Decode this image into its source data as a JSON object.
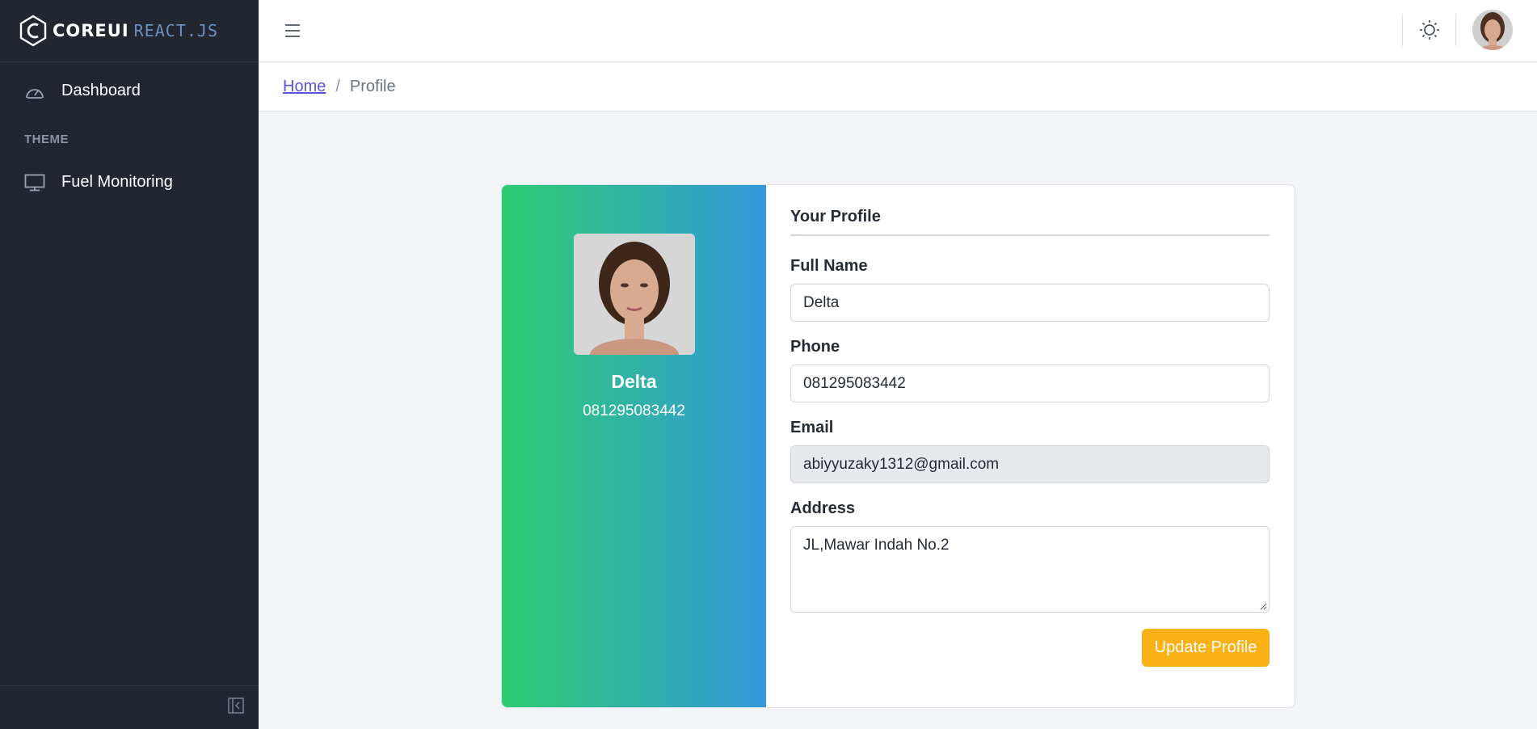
{
  "brand": {
    "core": "COREUI",
    "react": "REACT.JS"
  },
  "sidebar": {
    "items": [
      {
        "label": "Dashboard",
        "icon": "speedometer-icon"
      },
      {
        "label": "Fuel Monitoring",
        "icon": "monitor-icon"
      }
    ],
    "section_title": "THEME"
  },
  "header": {
    "menu_icon": "hamburger-icon",
    "theme_icon": "sun-icon"
  },
  "breadcrumb": {
    "home": "Home",
    "separator": "/",
    "current": "Profile"
  },
  "profile": {
    "name": "Delta",
    "phone": "081295083442"
  },
  "form": {
    "title": "Your Profile",
    "full_name_label": "Full Name",
    "full_name_value": "Delta",
    "phone_label": "Phone",
    "phone_value": "081295083442",
    "email_label": "Email",
    "email_value": "abiyyuzaky1312@gmail.com",
    "address_label": "Address",
    "address_value": "JL,Mawar Indah No.2",
    "submit_label": "Update Profile"
  },
  "colors": {
    "sidebar_bg": "#212631",
    "gradient_start": "#2ecc71",
    "gradient_end": "#3498db",
    "button": "#f9b115",
    "link": "#5856d6"
  }
}
